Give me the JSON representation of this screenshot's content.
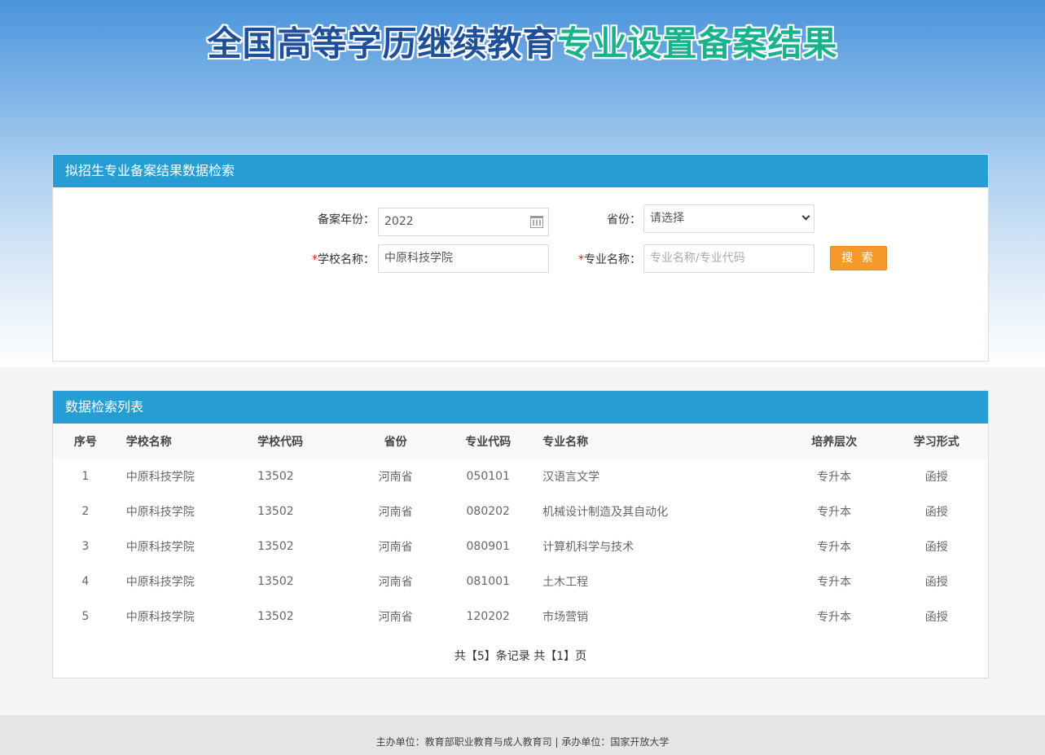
{
  "header": {
    "title_part1": "全国高等学历继续教育",
    "title_part2": "专业设置备案结果"
  },
  "search": {
    "heading": "拟招生专业备案结果数据检索",
    "year_label": "备案年份：",
    "year_value": "2022",
    "province_label": "省份：",
    "province_value": "请选择",
    "school_label": "学校名称：",
    "school_value": "中原科技学院",
    "major_label": "专业名称：",
    "major_placeholder": "专业名称/专业代码",
    "search_button": "搜 索",
    "required_mark": "*"
  },
  "results": {
    "heading": "数据检索列表",
    "columns": [
      "序号",
      "学校名称",
      "学校代码",
      "省份",
      "专业代码",
      "专业名称",
      "培养层次",
      "学习形式"
    ],
    "rows": [
      [
        "1",
        "中原科技学院",
        "13502",
        "河南省",
        "050101",
        "汉语言文学",
        "专升本",
        "函授"
      ],
      [
        "2",
        "中原科技学院",
        "13502",
        "河南省",
        "080202",
        "机械设计制造及其自动化",
        "专升本",
        "函授"
      ],
      [
        "3",
        "中原科技学院",
        "13502",
        "河南省",
        "080901",
        "计算机科学与技术",
        "专升本",
        "函授"
      ],
      [
        "4",
        "中原科技学院",
        "13502",
        "河南省",
        "081001",
        "土木工程",
        "专升本",
        "函授"
      ],
      [
        "5",
        "中原科技学院",
        "13502",
        "河南省",
        "120202",
        "市场营销",
        "专升本",
        "函授"
      ]
    ],
    "pager": {
      "prefix": "共【",
      "records": "5",
      "middle": "】条记录 共【",
      "pages": "1",
      "suffix": "】页"
    }
  },
  "footer": {
    "text": "主办单位：教育部职业教育与成人教育司 | 承办单位：国家开放大学"
  }
}
